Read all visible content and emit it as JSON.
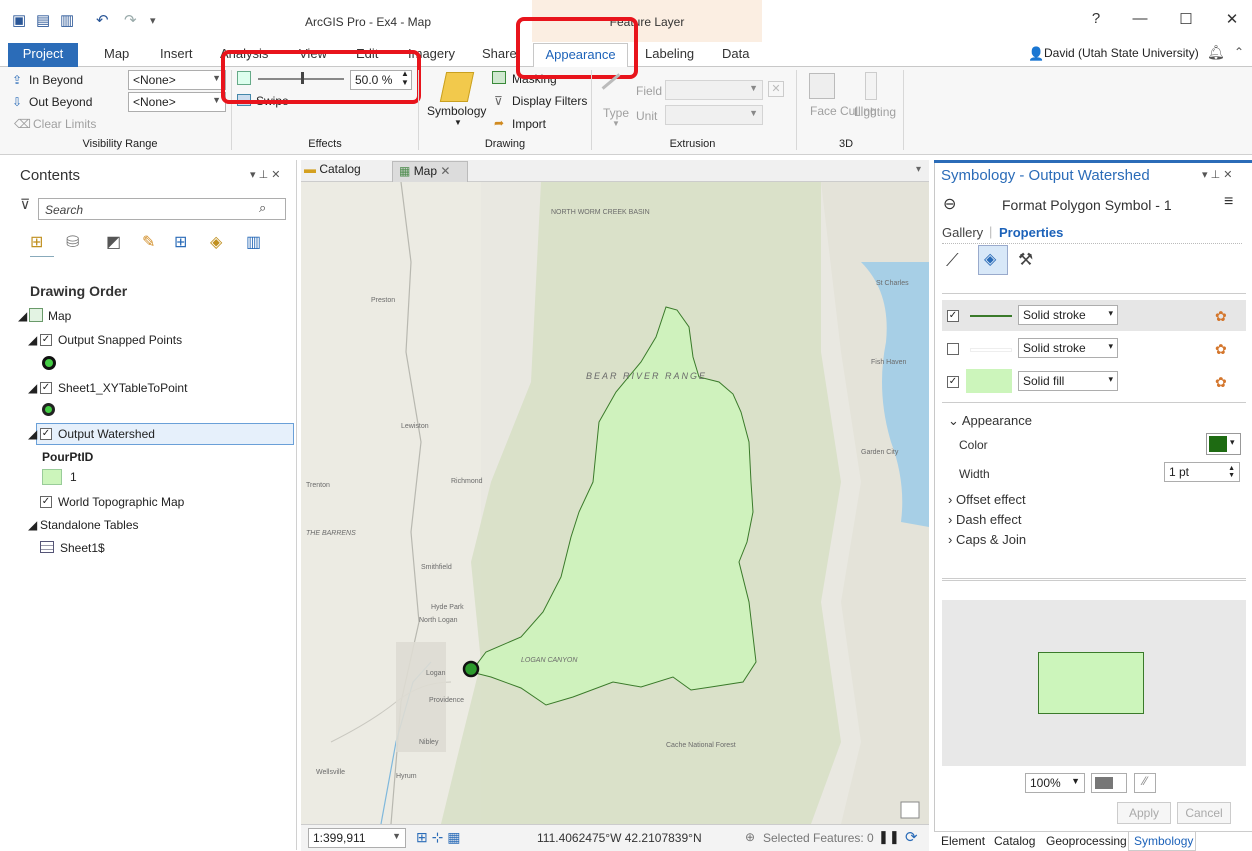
{
  "window": {
    "title": "ArcGIS Pro - Ex4 - Map",
    "context_tab_group": "Feature Layer",
    "user": "David (Utah State University)",
    "help": "?",
    "minimize": "—",
    "maximize": "☐",
    "close": "✕"
  },
  "tabs": [
    "Project",
    "Map",
    "Insert",
    "Analysis",
    "View",
    "Edit",
    "Imagery",
    "Share",
    "Appearance",
    "Labeling",
    "Data"
  ],
  "ribbon": {
    "visibility": {
      "in_beyond": "In Beyond",
      "out_beyond": "Out Beyond",
      "clear_limits": "Clear Limits",
      "in_value": "<None>",
      "out_value": "<None>",
      "group": "Visibility Range"
    },
    "effects": {
      "transparency": "50.0 %",
      "transparency_value": 0.5,
      "swipe": "Swipe",
      "group": "Effects"
    },
    "drawing": {
      "symbology": "Symbology",
      "masking": "Masking",
      "display_filters": "Display Filters",
      "import": "Import",
      "group": "Drawing"
    },
    "extrusion": {
      "type": "Type",
      "field": "Field",
      "unit": "Unit",
      "group": "Extrusion"
    },
    "d3": {
      "face_culling": "Face Culling",
      "lighting": "Lighting",
      "group": "3D"
    }
  },
  "contents": {
    "title": "Contents",
    "search_placeholder": "Search",
    "drawing_order": "Drawing Order",
    "layers": {
      "map": "Map",
      "snapped": "Output Snapped Points",
      "xy": "Sheet1_XYTableToPoint",
      "watershed": "Output Watershed",
      "pourpt_field": "PourPtID",
      "pourpt_value": "1",
      "topo": "World Topographic Map",
      "standalone": "Standalone Tables",
      "sheet": "Sheet1$"
    }
  },
  "map_tabs": {
    "catalog": "Catalog",
    "map": "Map"
  },
  "map": {
    "labels": [
      "NORTH WORM CREEK BASIN",
      "Preston",
      "BEAR RIVER RANGE",
      "St Charles",
      "Fish Haven",
      "Garden City",
      "Lewiston",
      "Richmond",
      "Trenton",
      "THE BARRENS",
      "Smithfield",
      "Hyde Park",
      "North Logan",
      "Logan",
      "Providence",
      "Nibley",
      "Hyrum",
      "Wellsville",
      "LOGAN CANYON",
      "Cache National Forest"
    ]
  },
  "statusbar": {
    "scale": "1:399,911",
    "coords": "111.4062475°W 42.2107839°N",
    "selected": "Selected Features: 0"
  },
  "symbology": {
    "title": "Symbology - Output Watershed",
    "subtitle": "Format Polygon Symbol - 1",
    "gallery": "Gallery",
    "properties": "Properties",
    "layers": [
      {
        "label": "Solid stroke",
        "checked": true,
        "color": "#3a7a2a"
      },
      {
        "label": "Solid stroke",
        "checked": false,
        "color": "#ffffff"
      },
      {
        "label": "Solid fill",
        "checked": true,
        "color": "#ccf5bb"
      }
    ],
    "appearance": "Appearance",
    "color_label": "Color",
    "color_value": "#1e6b12",
    "width_label": "Width",
    "width_value": "1 pt",
    "offset": "Offset effect",
    "dash": "Dash effect",
    "caps": "Caps & Join",
    "zoom": "100%",
    "apply": "Apply",
    "cancel": "Cancel"
  },
  "bottom_tabs": [
    "Element",
    "Catalog",
    "Geoprocessing",
    "Symbology"
  ]
}
